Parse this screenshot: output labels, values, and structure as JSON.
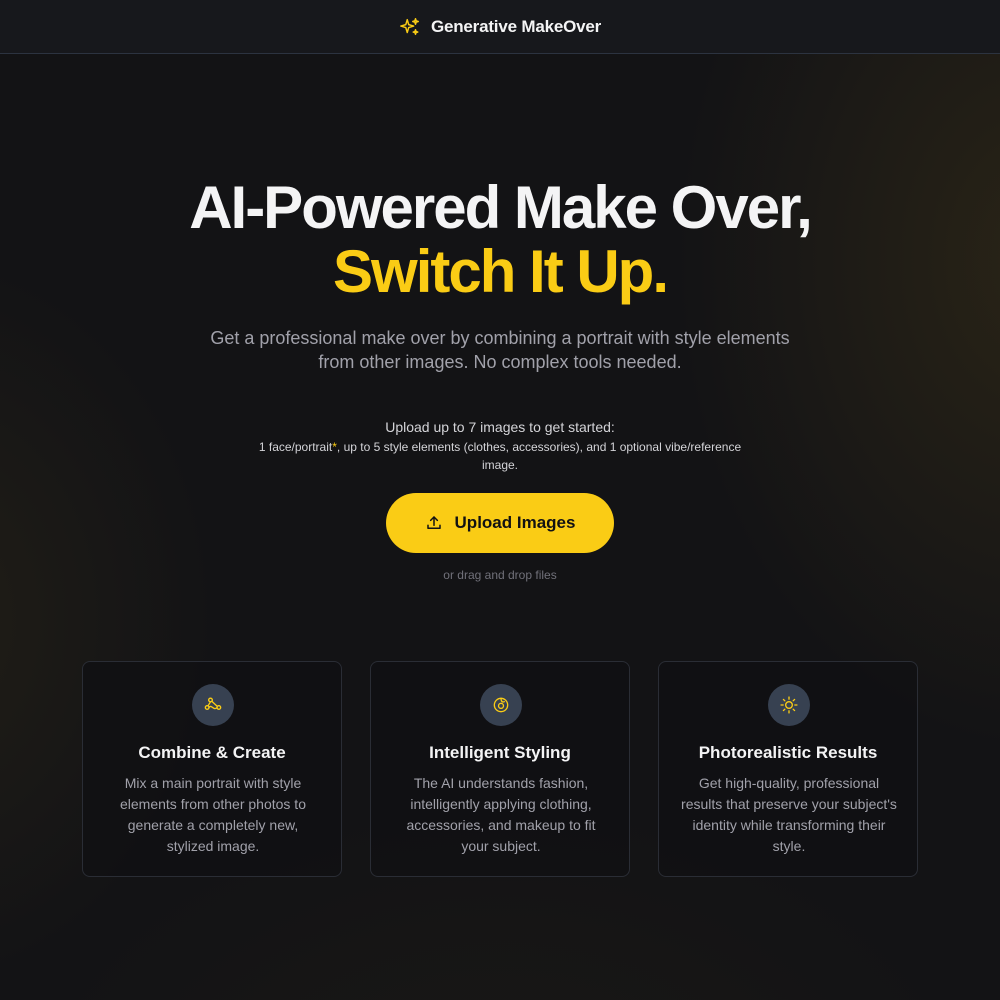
{
  "header": {
    "title": "Generative MakeOver",
    "icon": "sparkles-icon"
  },
  "hero": {
    "title_line1": "AI-Powered Make Over,",
    "title_line2": "Switch It Up.",
    "subtitle": "Get a professional make over by combining a portrait with style elements from other images. No complex tools needed."
  },
  "upload": {
    "lead": "Upload up to 7 images to get started:",
    "detail_prefix": "1 face/portrait",
    "required_marker": "*",
    "detail_suffix": ", up to 5 style elements (clothes, accessories), and 1 optional vibe/reference image.",
    "button_label": "Upload Images",
    "button_icon": "upload-icon",
    "drag_hint": "or drag and drop files"
  },
  "features": [
    {
      "icon": "combine-icon",
      "title": "Combine & Create",
      "description": "Mix a main portrait with style elements from other photos to generate a completely new, stylized image."
    },
    {
      "icon": "palette-icon",
      "title": "Intelligent Styling",
      "description": "The AI understands fashion, intelligently applying clothing, accessories, and makeup to fit your subject."
    },
    {
      "icon": "sun-icon",
      "title": "Photorealistic Results",
      "description": "Get high-quality, professional results that preserve your subject's identity while transforming their style."
    }
  ],
  "colors": {
    "accent": "#facc15",
    "background": "#131315",
    "card_icon_bg": "#374151"
  }
}
